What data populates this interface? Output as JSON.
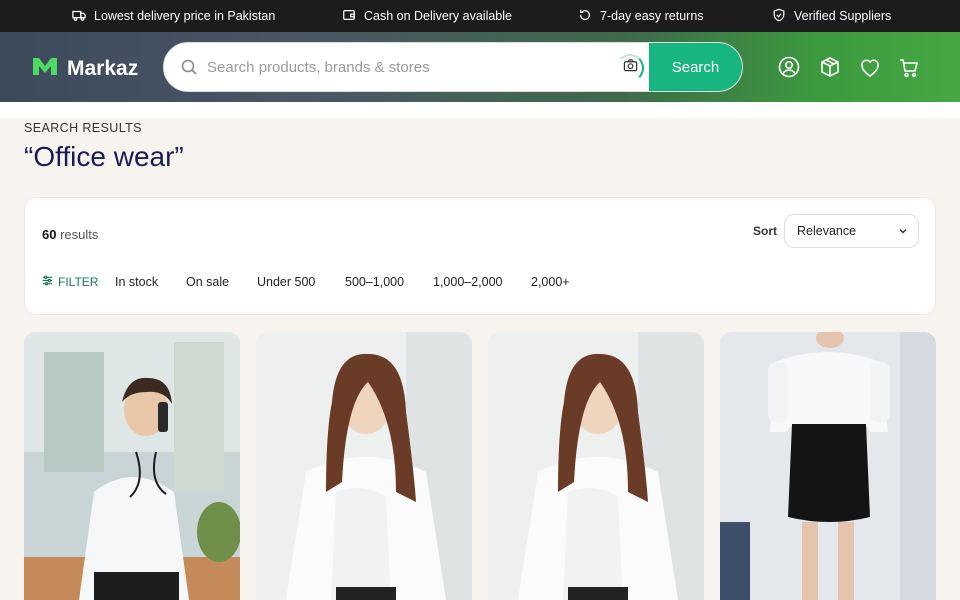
{
  "topbar": {
    "items": [
      {
        "icon": "truck-icon",
        "label": "Lowest delivery price in Pakistan"
      },
      {
        "icon": "wallet-icon",
        "label": "Cash on Delivery available"
      },
      {
        "icon": "return-icon",
        "label": "7-day easy returns"
      },
      {
        "icon": "shield-icon",
        "label": "Verified Suppliers"
      }
    ]
  },
  "header": {
    "logo_text": "Markaz",
    "search": {
      "placeholder": "Search products, brands & stores",
      "value": "",
      "button_label": "Search"
    },
    "icons": [
      "user-icon",
      "box-icon",
      "heart-icon",
      "cart-icon"
    ]
  },
  "results": {
    "label": "SEARCH RESULTS",
    "query_title": "“Office wear”",
    "count": "60",
    "count_suffix": "results",
    "sort_label": "Sort",
    "sort_value": "Relevance",
    "filters": [
      "FILTER",
      "In stock",
      "On sale",
      "Under 500",
      "500–1,000",
      "1,000–2,000",
      "2,000+"
    ]
  },
  "colors": {
    "accent": "#17b681",
    "title": "#1b1b55",
    "topbar_bg": "#1c1c1c"
  }
}
